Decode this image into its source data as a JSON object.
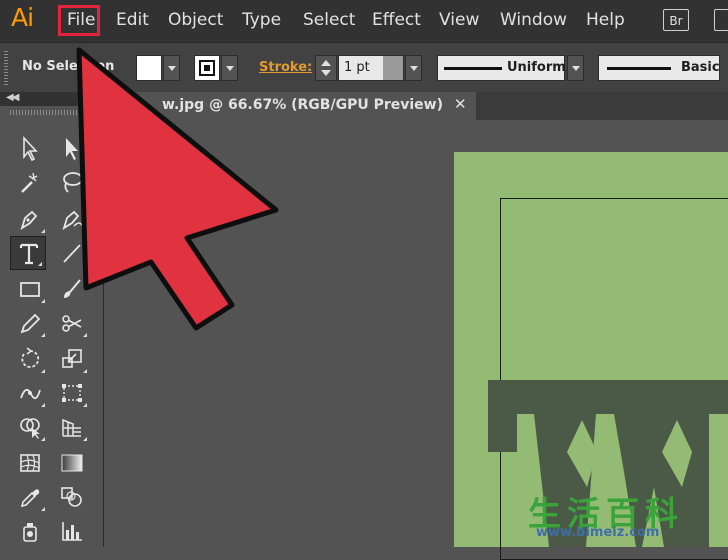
{
  "app": {
    "logo": "Ai",
    "bridge_label": "Br"
  },
  "menu": {
    "items": [
      "File",
      "Edit",
      "Object",
      "Type",
      "Select",
      "Effect",
      "View",
      "Window",
      "Help"
    ],
    "highlighted": "File"
  },
  "control_bar": {
    "selection_label": "No Selection",
    "stroke_label": "Stroke:",
    "stroke_weight": "1 pt",
    "profile_label": "Uniform",
    "brush_label": "Basic"
  },
  "document": {
    "tab_title": "w.jpg @ 66.67% (RGB/GPU Preview)",
    "close_glyph": "✕"
  },
  "watermark": {
    "text": "生活百科",
    "url": "www.bimeiz.com"
  },
  "colors": {
    "menu_bg": "#323232",
    "accent_orange": "#ff9a00",
    "highlight_red": "#e3243b",
    "artboard_green": "#94bb73",
    "letter_dark": "#4a5a47"
  },
  "icons": [
    "selection-tool-icon",
    "direct-selection-tool-icon",
    "magic-wand-tool-icon",
    "lasso-tool-icon",
    "pen-tool-icon",
    "curvature-tool-icon",
    "type-tool-icon",
    "line-tool-icon",
    "rectangle-tool-icon",
    "paintbrush-tool-icon",
    "pencil-tool-icon",
    "scissors-tool-icon",
    "rotate-tool-icon",
    "scale-tool-icon",
    "width-tool-icon",
    "free-transform-tool-icon",
    "shape-builder-tool-icon",
    "perspective-grid-tool-icon",
    "mesh-tool-icon",
    "gradient-tool-icon",
    "eyedropper-tool-icon",
    "blend-tool-icon",
    "symbol-sprayer-tool-icon",
    "graph-tool-icon"
  ]
}
